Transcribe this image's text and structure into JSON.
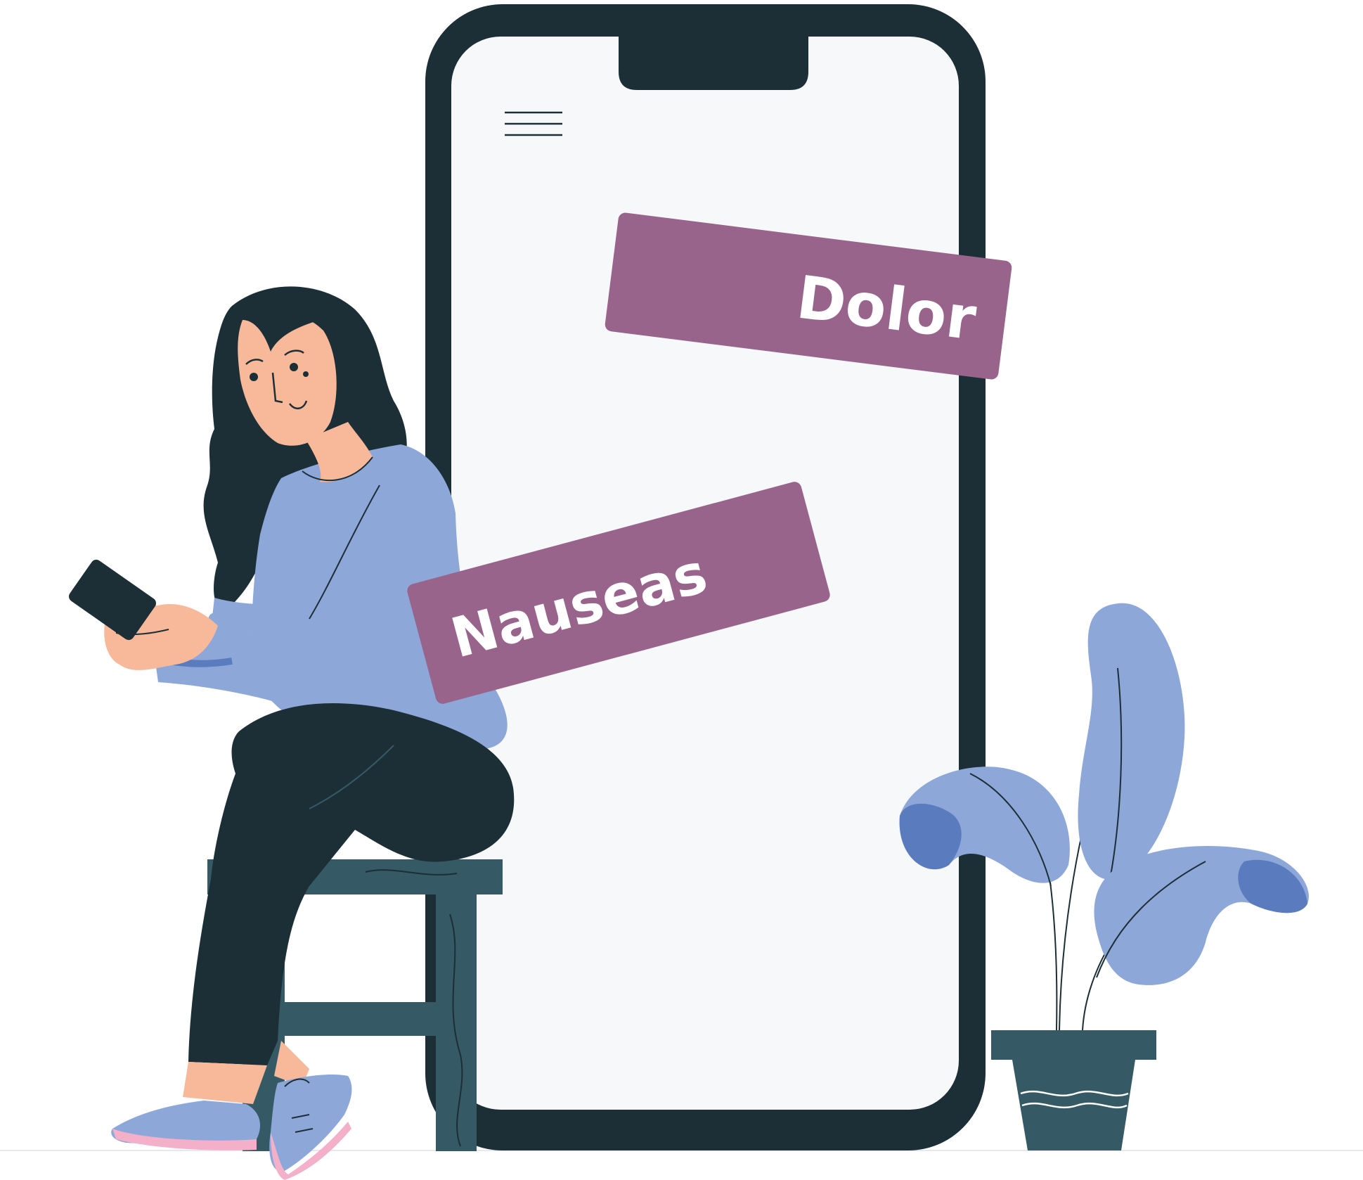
{
  "tags": {
    "dolor": "Dolor",
    "nauseas": "Nauseas"
  },
  "colors": {
    "phone_frame": "#1c2e36",
    "phone_screen": "#f7f8fa",
    "tag": "#98648b",
    "sweater": "#8da8d8",
    "sweater_shadow": "#5a7bbd",
    "skin": "#f8b99b",
    "hair": "#1c2e36",
    "pants": "#1c2e36",
    "stool": "#355a65",
    "plant_leaf": "#8da8d8",
    "plant_leaf_dark": "#5a7bbd",
    "pot": "#355a65",
    "shoe_sole": "#f4b0c8"
  }
}
